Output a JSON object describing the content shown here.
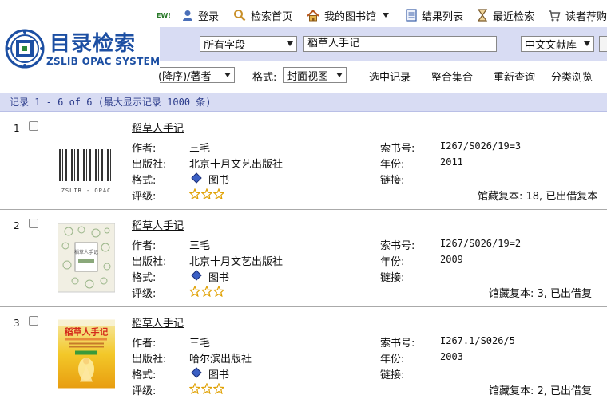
{
  "topnav": {
    "ew_badge": "EW!",
    "login": "登录",
    "search_home": "检索首页",
    "my_library": "我的图书馆",
    "result_list": "结果列表",
    "recent_search": "最近检索",
    "reader_recommend": "读者荐购"
  },
  "logo": {
    "title": "目录检索",
    "subtitle": "ZSLIB OPAC SYSTEM"
  },
  "search": {
    "field_select": "所有字段",
    "query_value": "稻草人手记",
    "database_select": "中文文献库"
  },
  "toolbar": {
    "sort_select": "(降序)/著者",
    "format_label": "格式:",
    "format_select": "封面视图",
    "selected_records": "选中记录",
    "merge_set": "整合集合",
    "requery": "重新查询",
    "browse_class": "分类浏览"
  },
  "result_bar": {
    "text": "记录 1 - 6 of 6 (最大显示记录 1000 条)"
  },
  "labels": {
    "author": "作者:",
    "publisher": "出版社:",
    "format": "格式:",
    "rating": "评级:",
    "call_no": "索书号:",
    "year": "年份:",
    "link": "链接:"
  },
  "records": [
    {
      "num": "1",
      "title": "稻草人手记",
      "author": "三毛",
      "publisher": "北京十月文艺出版社",
      "format": "图书",
      "call_no": "I267/S026/19=3",
      "year": "2011",
      "holdings": "馆藏复本: 18, 已出借复本",
      "cover_text": "ZSLIB - OPAC"
    },
    {
      "num": "2",
      "title": "稻草人手记",
      "author": "三毛",
      "publisher": "北京十月文艺出版社",
      "format": "图书",
      "call_no": "I267/S026/19=2",
      "year": "2009",
      "holdings": "馆藏复本: 3, 已出借复",
      "cover_text": "稻草人手记"
    },
    {
      "num": "3",
      "title": "稻草人手记",
      "author": "三毛",
      "publisher": "哈尔滨出版社",
      "format": "图书",
      "call_no": "I267.1/S026/5",
      "year": "2003",
      "holdings": "馆藏复本: 2, 已出借复",
      "cover_text": "稻草人手记"
    }
  ],
  "colors": {
    "accent": "#1c4fa3",
    "bar": "#d8dcf3",
    "star": "#e0a000"
  }
}
